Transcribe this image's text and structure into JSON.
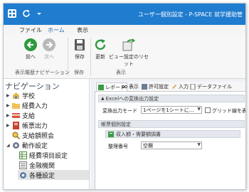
{
  "titlebar": {
    "title": "ユーザー個別設定 - P-SPACE 就学援助管"
  },
  "ribbon_tabs": [
    "ファイル",
    "ホーム",
    "表示"
  ],
  "ribbon": {
    "back": "前へ",
    "forward": "次へ",
    "save": "保存",
    "refresh": "更新",
    "reset": "ビュー設定のリセット",
    "group_history": "表示履歴ナビゲーション",
    "group_save": "保存",
    "group_view": "表示"
  },
  "nav": {
    "title": "ナビゲーション",
    "items": [
      "学校",
      "経費入力",
      "支給",
      "帳票出力",
      "支給額照会",
      "動作設定",
      "経費項目設定",
      "金融機関",
      "各種設定"
    ]
  },
  "content_tabs": [
    "レポート",
    "表示",
    "許可設定",
    "入力",
    "データファイル"
  ],
  "excel": {
    "header": "Excelへの変換出力設定",
    "mode_label": "変換出力モード",
    "mode_value": "1ページを1シートに...",
    "grid_label": "グリッド線を表示"
  },
  "form": {
    "header": "帳票個別設定",
    "subheader": "収入額・需要額調書",
    "sort_label": "整理番号",
    "sort_value": "空欄"
  },
  "colors": {
    "titlebar": "#1f7ccf",
    "accent": "#1f64b4"
  }
}
